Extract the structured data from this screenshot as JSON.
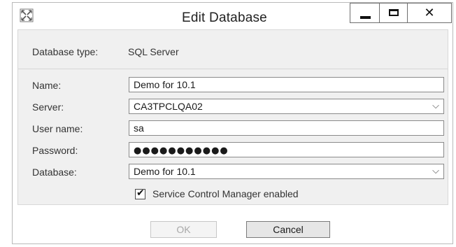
{
  "window": {
    "title": "Edit Database",
    "icon": "database-app-icon",
    "controls": {
      "minimize": "minimize-icon",
      "maximize": "maximize-icon",
      "close": "close-icon"
    }
  },
  "database_type": {
    "label": "Database type:",
    "value": "SQL Server"
  },
  "form": {
    "name": {
      "label": "Name:",
      "value": "Demo for 10.1"
    },
    "server": {
      "label": "Server:",
      "value": "CA3TPCLQA02"
    },
    "user_name": {
      "label": "User name:",
      "value": "sa"
    },
    "password": {
      "label": "Password:",
      "value": "●●●●●●●●●●●"
    },
    "database": {
      "label": "Database:",
      "value": "Demo for 10.1"
    }
  },
  "service_control_manager": {
    "label": "Service Control Manager enabled",
    "checked": true
  },
  "buttons": {
    "ok": "OK",
    "cancel": "Cancel"
  }
}
